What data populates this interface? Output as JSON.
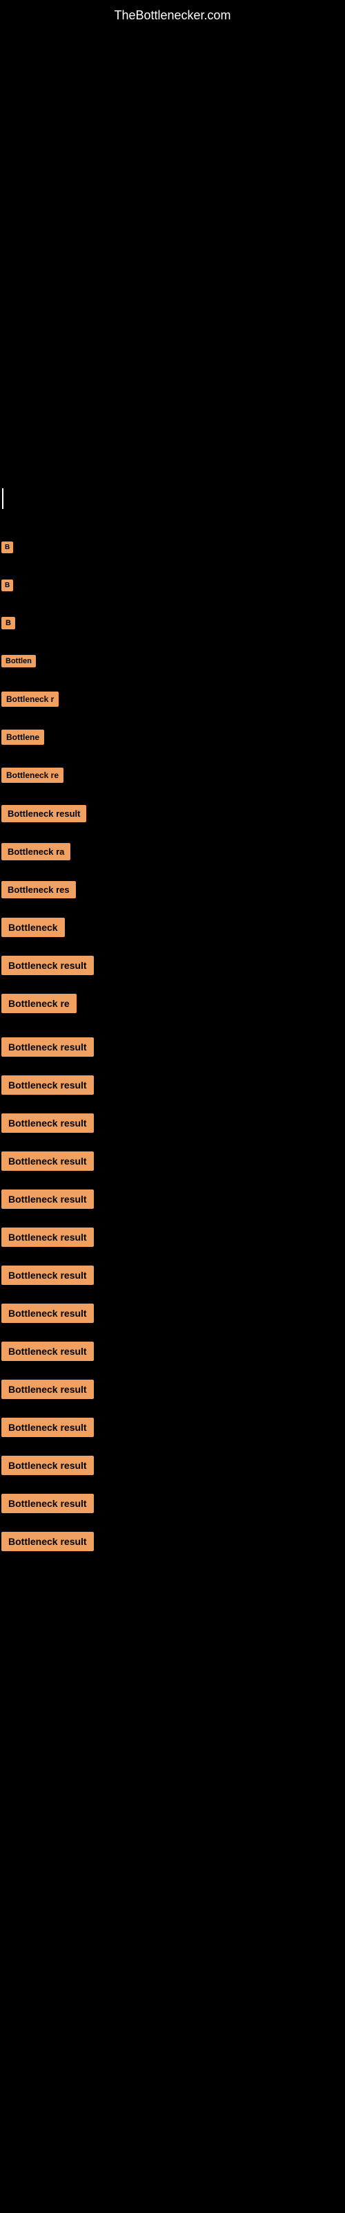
{
  "site": {
    "title": "TheBottlenecker.com"
  },
  "labels": {
    "bottleneck_result": "Bottleneck result",
    "bottleneck_r": "Bottleneck r",
    "bottleneck_re": "Bottleneck re",
    "bottleneck_res": "Bottleneck res",
    "bottleneck": "Bottleneck",
    "b_short1": "B",
    "b_short2": "B",
    "b_short3": "B"
  },
  "colors": {
    "background": "#000000",
    "label_bg": "#f0a060",
    "text_white": "#ffffff",
    "text_black": "#000000"
  }
}
